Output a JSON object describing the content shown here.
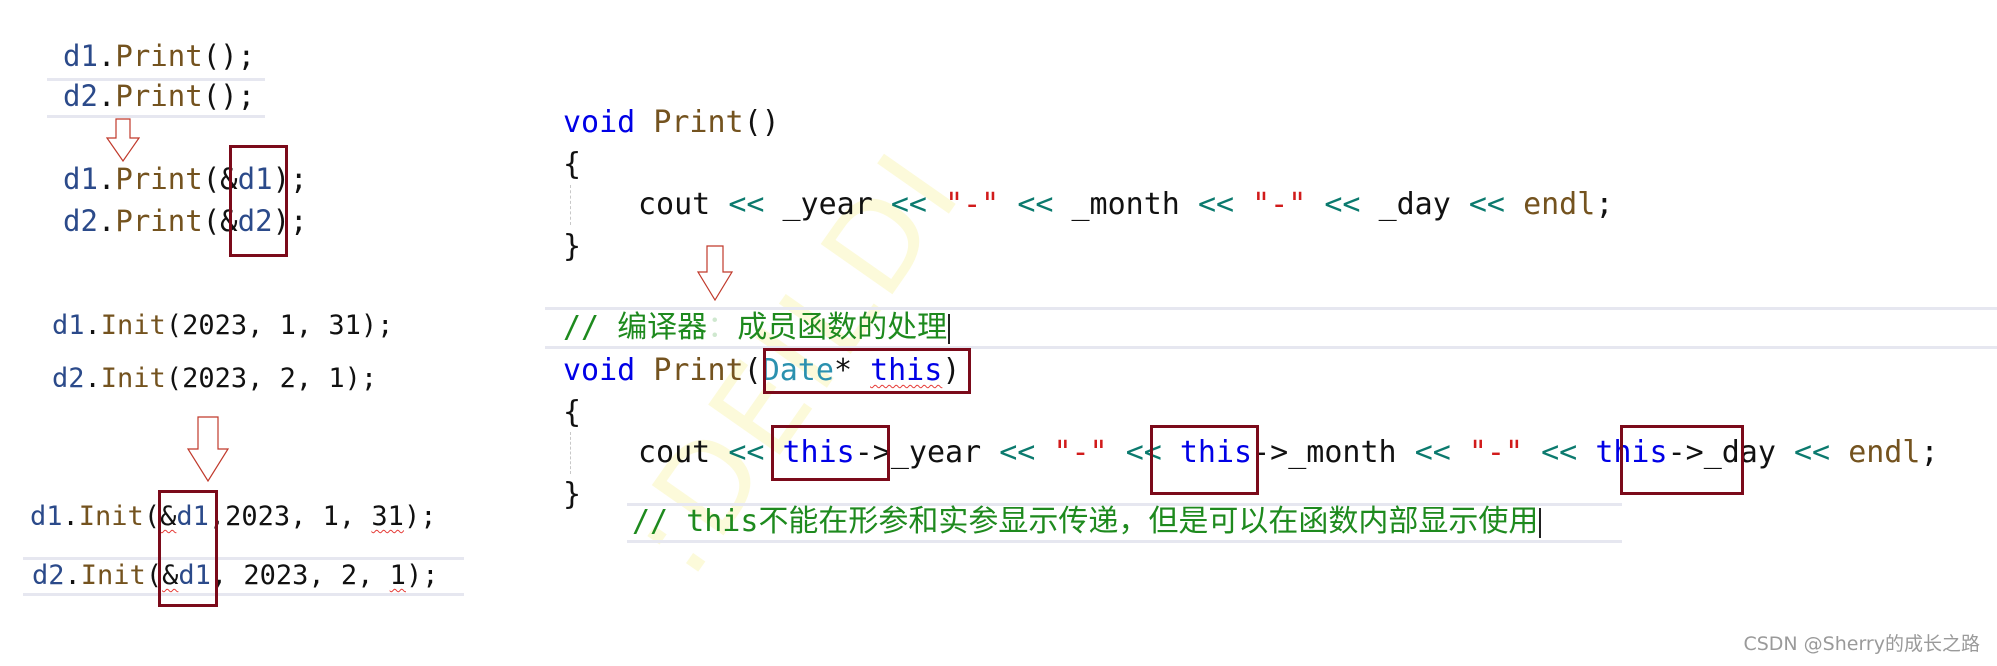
{
  "left": {
    "print_before": [
      {
        "obj": "d1",
        "dot": ".",
        "fn": "Print",
        "args": "();"
      },
      {
        "obj": "d2",
        "dot": ".",
        "fn": "Print",
        "args": "();"
      }
    ],
    "print_after": [
      {
        "obj": "d1",
        "dot": ".",
        "fn": "Print",
        "open": "(",
        "amp": "&",
        "ref": "d1",
        "close": ");"
      },
      {
        "obj": "d2",
        "dot": ".",
        "fn": "Print",
        "open": "(",
        "amp": "&",
        "ref": "d2",
        "close": ");"
      }
    ],
    "init_before": [
      {
        "obj": "d1",
        "dot": ".",
        "fn": "Init",
        "args": "(2023, 1, 31);"
      },
      {
        "obj": "d2",
        "dot": ".",
        "fn": "Init",
        "args": "(2023, 2, 1);"
      }
    ],
    "init_after": [
      {
        "obj": "d1",
        "dot": ".",
        "fn": "Init",
        "open": "(",
        "amp": "&",
        "ref": "d1",
        "rest_a": ",2023, 1, ",
        "squig": "31",
        "rest_b": ");"
      },
      {
        "obj": "d2",
        "dot": ".",
        "fn": "Init",
        "open": "(",
        "amp": "&",
        "ref": "d1",
        "rest_a": ", 2023, 2, ",
        "squig": "1",
        "rest_b": ");"
      }
    ]
  },
  "right": {
    "original": {
      "kw": "void",
      "fn": "Print",
      "parens": "()",
      "open_brace": "{",
      "close_brace": "}",
      "body": {
        "cout": "cout",
        "op": "<<",
        "year": "_year",
        "dash": "\"-\"",
        "month": "_month",
        "day": "_day",
        "endl": "endl",
        "semi": ";"
      }
    },
    "compiler_comment": {
      "slashes": "//",
      "label": "编译器",
      "colon": "：",
      "text": "成员函数的处理"
    },
    "transformed": {
      "kw": "void",
      "fn": "Print",
      "open": "(",
      "type": "Date",
      "star": "*",
      "this": "this",
      "close": ")",
      "open_brace": "{",
      "close_brace": "}",
      "body": {
        "cout": "cout",
        "op": "<<",
        "this_arrow": "this",
        "arrow": "->",
        "year": "_year",
        "dash": "\"-\"",
        "month": "_month",
        "day": "_day",
        "endl": "endl",
        "semi": ";"
      }
    },
    "note_comment": {
      "slashes": "//",
      "text_kw": "this",
      "text": "不能在形参和实参显示传递，但是可以在函数内部显示使用"
    }
  },
  "watermark": "CSDN @Sherry的成长之路",
  "colors": {
    "box": "#7b0a1a",
    "arrow": "#c0392b",
    "comment": "#1e8a1e",
    "keyword": "#0000e6"
  }
}
